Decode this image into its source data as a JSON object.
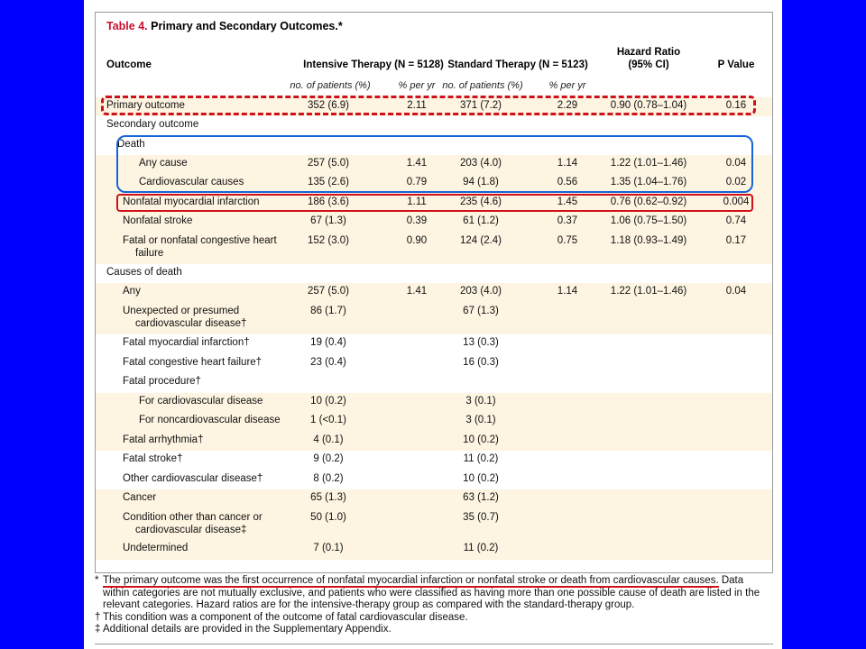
{
  "table": {
    "title_label": "Table 4.",
    "title_text": "Primary and Secondary Outcomes.*",
    "headers": {
      "outcome": "Outcome",
      "intensive": "Intensive Therapy (N = 5128)",
      "standard": "Standard Therapy (N = 5123)",
      "hr_line1": "Hazard Ratio",
      "hr_line2": "(95% CI)",
      "p": "P Value"
    },
    "subheaders": {
      "int_n": "no. of patients (%)",
      "int_rate": "% per yr",
      "std_n": "no. of patients (%)",
      "std_rate": "% per yr"
    },
    "rows": [
      {
        "label": "Primary outcome",
        "int_n": "352 (6.9)",
        "int_rate": "2.11",
        "std_n": "371 (7.2)",
        "std_rate": "2.29",
        "hr": "0.90 (0.78–1.04)",
        "p": "0.16"
      },
      {
        "label": "Secondary outcome",
        "int_n": "",
        "int_rate": "",
        "std_n": "",
        "std_rate": "",
        "hr": "",
        "p": ""
      },
      {
        "label": "Death",
        "int_n": "",
        "int_rate": "",
        "std_n": "",
        "std_rate": "",
        "hr": "",
        "p": ""
      },
      {
        "label": "Any cause",
        "int_n": "257 (5.0)",
        "int_rate": "1.41",
        "std_n": "203 (4.0)",
        "std_rate": "1.14",
        "hr": "1.22 (1.01–1.46)",
        "p": "0.04"
      },
      {
        "label": "Cardiovascular causes",
        "int_n": "135 (2.6)",
        "int_rate": "0.79",
        "std_n": "94 (1.8)",
        "std_rate": "0.56",
        "hr": "1.35 (1.04–1.76)",
        "p": "0.02"
      },
      {
        "label": "Nonfatal myocardial infarction",
        "int_n": "186 (3.6)",
        "int_rate": "1.11",
        "std_n": "235 (4.6)",
        "std_rate": "1.45",
        "hr": "0.76 (0.62–0.92)",
        "p": "0.004"
      },
      {
        "label": "Nonfatal stroke",
        "int_n": "67 (1.3)",
        "int_rate": "0.39",
        "std_n": "61 (1.2)",
        "std_rate": "0.37",
        "hr": "1.06 (0.75–1.50)",
        "p": "0.74"
      },
      {
        "label": "Fatal or nonfatal congestive heart failure",
        "int_n": "152 (3.0)",
        "int_rate": "0.90",
        "std_n": "124 (2.4)",
        "std_rate": "0.75",
        "hr": "1.18 (0.93–1.49)",
        "p": "0.17"
      },
      {
        "label": "Causes of death",
        "int_n": "",
        "int_rate": "",
        "std_n": "",
        "std_rate": "",
        "hr": "",
        "p": ""
      },
      {
        "label": "Any",
        "int_n": "257 (5.0)",
        "int_rate": "1.41",
        "std_n": "203 (4.0)",
        "std_rate": "1.14",
        "hr": "1.22 (1.01–1.46)",
        "p": "0.04"
      },
      {
        "label": "Unexpected or presumed cardiovascular disease†",
        "int_n": "86 (1.7)",
        "int_rate": "",
        "std_n": "67 (1.3)",
        "std_rate": "",
        "hr": "",
        "p": ""
      },
      {
        "label": "Fatal myocardial infarction†",
        "int_n": "19 (0.4)",
        "int_rate": "",
        "std_n": "13 (0.3)",
        "std_rate": "",
        "hr": "",
        "p": ""
      },
      {
        "label": "Fatal congestive heart failure†",
        "int_n": "23 (0.4)",
        "int_rate": "",
        "std_n": "16 (0.3)",
        "std_rate": "",
        "hr": "",
        "p": ""
      },
      {
        "label": "Fatal procedure†",
        "int_n": "",
        "int_rate": "",
        "std_n": "",
        "std_rate": "",
        "hr": "",
        "p": ""
      },
      {
        "label": "For cardiovascular disease",
        "int_n": "10 (0.2)",
        "int_rate": "",
        "std_n": "3 (0.1)",
        "std_rate": "",
        "hr": "",
        "p": ""
      },
      {
        "label": "For noncardiovascular disease",
        "int_n": "1 (<0.1)",
        "int_rate": "",
        "std_n": "3 (0.1)",
        "std_rate": "",
        "hr": "",
        "p": ""
      },
      {
        "label": "Fatal arrhythmia†",
        "int_n": "4 (0.1)",
        "int_rate": "",
        "std_n": "10 (0.2)",
        "std_rate": "",
        "hr": "",
        "p": ""
      },
      {
        "label": "Fatal stroke†",
        "int_n": "9 (0.2)",
        "int_rate": "",
        "std_n": "11 (0.2)",
        "std_rate": "",
        "hr": "",
        "p": ""
      },
      {
        "label": "Other cardiovascular disease†",
        "int_n": "8 (0.2)",
        "int_rate": "",
        "std_n": "10 (0.2)",
        "std_rate": "",
        "hr": "",
        "p": ""
      },
      {
        "label": "Cancer",
        "int_n": "65 (1.3)",
        "int_rate": "",
        "std_n": "63 (1.2)",
        "std_rate": "",
        "hr": "",
        "p": ""
      },
      {
        "label": "Condition other than cancer or cardiovascular disease‡",
        "int_n": "50 (1.0)",
        "int_rate": "",
        "std_n": "35 (0.7)",
        "std_rate": "",
        "hr": "",
        "p": ""
      },
      {
        "label": "Undetermined",
        "int_n": "7 (0.1)",
        "int_rate": "",
        "std_n": "11 (0.2)",
        "std_rate": "",
        "hr": "",
        "p": ""
      }
    ],
    "footnotes": {
      "star_mark": "*",
      "star_underlined": "The primary outcome was the first occurrence of nonfatal myocardial infarction or nonfatal stroke or death from cardiovascular causes.",
      "star_rest": " Data within categories are not mutually exclusive, and patients who were classified as having more than one possible cause of death are listed in the relevant categories. Hazard ratios are for the intensive-therapy group as compared with the standard-therapy group.",
      "dagger_mark": "†",
      "dagger": "This condition was a component of the outcome of fatal cardiovascular disease.",
      "ddagger_mark": "‡",
      "ddagger": "Additional details are provided in the Supplementary Appendix."
    }
  },
  "colors": {
    "title_red": "#c8102e",
    "stripe": "#fdf4e1",
    "highlight_red": "#d0101b",
    "highlight_blue": "#1565d8",
    "background_blue": "#0000ff"
  }
}
